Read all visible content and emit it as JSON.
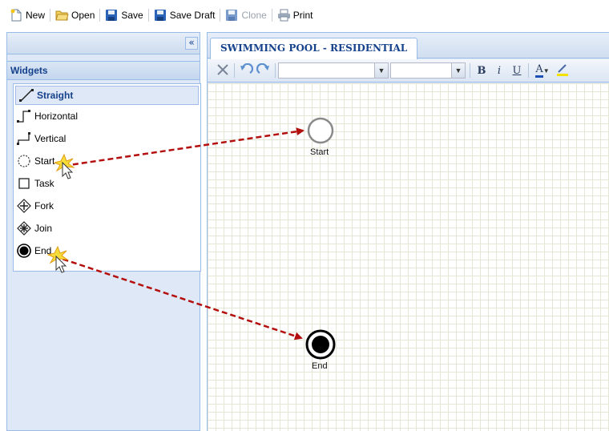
{
  "toolbar": {
    "new_label": "New",
    "open_label": "Open",
    "save_label": "Save",
    "save_draft_label": "Save Draft",
    "clone_label": "Clone",
    "print_label": "Print"
  },
  "left_panel": {
    "collapse_glyph": "«",
    "widgets_title": "Widgets",
    "items": [
      {
        "label": "Straight",
        "icon": "straight-line-icon",
        "selected": true
      },
      {
        "label": "Horizontal",
        "icon": "horizontal-connector-icon"
      },
      {
        "label": "Vertical",
        "icon": "vertical-connector-icon"
      },
      {
        "label": "Start",
        "icon": "start-circle-icon"
      },
      {
        "label": "Task",
        "icon": "task-square-icon"
      },
      {
        "label": "Fork",
        "icon": "fork-diamond-icon"
      },
      {
        "label": "Join",
        "icon": "join-diamond-icon"
      },
      {
        "label": "End",
        "icon": "end-circle-icon"
      }
    ]
  },
  "canvas": {
    "tab_title": "SWIMMING POOL - RESIDENTIAL",
    "nodes": {
      "start_label": "Start",
      "end_label": "End"
    }
  },
  "format_toolbar": {
    "bold": "B",
    "italic": "i",
    "underline": "U",
    "font_color": "A"
  },
  "colors": {
    "accent": "#15428b",
    "panel_border": "#99bbe8",
    "arrow": "#b40f0f"
  }
}
